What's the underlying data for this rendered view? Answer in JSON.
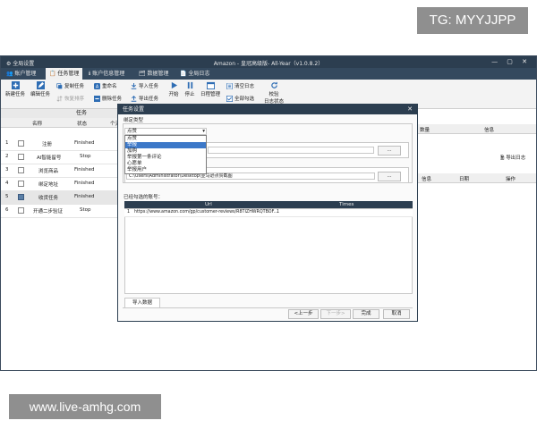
{
  "watermarks": {
    "top_right": "TG: MYYJJPP",
    "bottom_left": "www.live-amhg.com"
  },
  "app": {
    "menu_label": "全局设置",
    "title": "Amazon - 皇冠高级版- All-Year（v1.0.8.2）",
    "window_controls": "— ▢ ✕"
  },
  "nav_tabs": [
    {
      "label": "账户管理"
    },
    {
      "label": "任务管理"
    },
    {
      "label": "账户信息管理"
    },
    {
      "label": "数据管理"
    },
    {
      "label": "全局日志"
    }
  ],
  "toolbar": {
    "new_task": "新建任务",
    "edit_task": "编辑任务",
    "copy_task": "复制任务",
    "rename": "重命名",
    "import_task": "导入任务",
    "start": "开始",
    "stop": "停止",
    "schedule": "日程管理",
    "clear_log": "清空日志",
    "restore_order": "恢复排序",
    "delete_task": "删除任务",
    "export_task": "导出任务",
    "select_all": "全部勾选",
    "verify_log": "校验",
    "verify_log_2": "日志状态"
  },
  "task_table": {
    "group_header": "任务",
    "columns": [
      "名称",
      "状态",
      "个天"
    ],
    "rows": [
      {
        "num": "1",
        "name": "注册",
        "status": "Finished",
        "checked": false
      },
      {
        "num": "2",
        "name": "AI智能留号",
        "status": "Stop",
        "checked": false
      },
      {
        "num": "3",
        "name": "浏览商品",
        "status": "Finished",
        "checked": false
      },
      {
        "num": "4",
        "name": "绑定地址",
        "status": "Finished",
        "checked": false
      },
      {
        "num": "5",
        "name": "收货任务",
        "status": "Finished",
        "checked": true
      },
      {
        "num": "6",
        "name": "开通二步验证",
        "status": "Stop",
        "checked": false
      }
    ]
  },
  "right_panel": {
    "top_columns": [
      "数量",
      "信息"
    ],
    "export_log": "导出日志",
    "bottom_columns": [
      "信息",
      "日期",
      "操作"
    ]
  },
  "dialog": {
    "title": "任务设置",
    "section_label": "绑定类型",
    "select_value": "点赞",
    "options": [
      "点赞",
      "举报",
      "加购",
      "举报第一条评论",
      "心愿单",
      "举报用户"
    ],
    "highlight_index": 1,
    "path_value": "C:\\Users\\Administrator\\Desktop\\亚马逊点赞截图",
    "browse_1": "...",
    "browse_2": "...",
    "accounts_label": "已经勾选的账号：",
    "grid_columns": [
      "Url",
      "Times"
    ],
    "grid_rows": [
      {
        "num": "1",
        "url": "https://www.amazon.com/gp/customer-reviews/R8TIZHWRQTBOF...",
        "times": "1"
      }
    ],
    "import_tab": "导入数据",
    "prev": "<上一步",
    "next": "下一步>",
    "finish": "完成",
    "cancel": "取消"
  }
}
